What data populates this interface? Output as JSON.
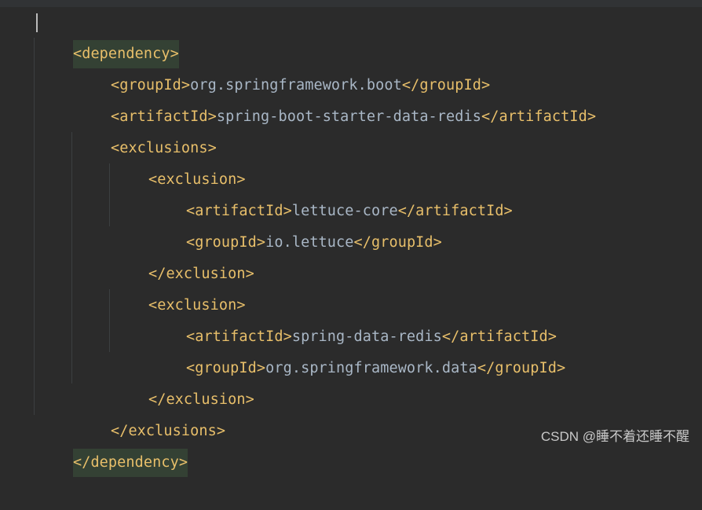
{
  "code_lines": [
    {
      "open": "<",
      "name": "dependency",
      "close": ">",
      "text": "",
      "end": ""
    },
    {
      "open": "<",
      "name": "groupId",
      "close": ">",
      "text": "org.springframework.boot",
      "end": "</groupId>"
    },
    {
      "open": "<",
      "name": "artifactId",
      "close": ">",
      "text": "spring-boot-starter-data-redis",
      "end": "</artifactId>"
    },
    {
      "open": "<",
      "name": "exclusions",
      "close": ">",
      "text": "",
      "end": ""
    },
    {
      "open": "<",
      "name": "exclusion",
      "close": ">",
      "text": "",
      "end": ""
    },
    {
      "open": "<",
      "name": "artifactId",
      "close": ">",
      "text": "lettuce-core",
      "end": "</artifactId>"
    },
    {
      "open": "<",
      "name": "groupId",
      "close": ">",
      "text": "io.lettuce",
      "end": "</groupId>"
    },
    {
      "open": "</",
      "name": "exclusion",
      "close": ">",
      "text": "",
      "end": ""
    },
    {
      "open": "<",
      "name": "exclusion",
      "close": ">",
      "text": "",
      "end": ""
    },
    {
      "open": "<",
      "name": "artifactId",
      "close": ">",
      "text": "spring-data-redis",
      "end": "</artifactId>"
    },
    {
      "open": "<",
      "name": "groupId",
      "close": ">",
      "text": "org.springframework.data",
      "end": "</groupId>"
    },
    {
      "open": "</",
      "name": "exclusion",
      "close": ">",
      "text": "",
      "end": ""
    },
    {
      "open": "</",
      "name": "exclusions",
      "close": ">",
      "text": "",
      "end": ""
    },
    {
      "open": "</",
      "name": "dependency",
      "close": ">",
      "text": "",
      "end": ""
    }
  ],
  "watermark": "CSDN @睡不着还睡不醒",
  "colors": {
    "background": "#2b2b2b",
    "tag": "#e8bf6a",
    "text": "#a9b7c6",
    "highlight": "#344134"
  }
}
